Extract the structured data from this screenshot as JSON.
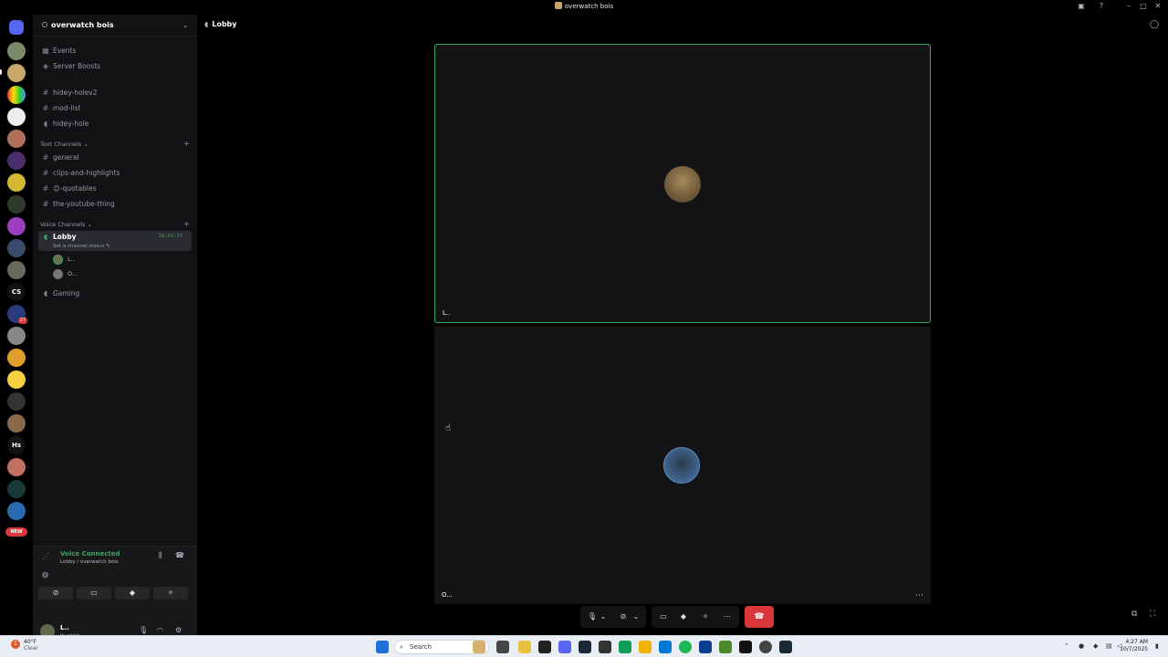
{
  "titlebar": {
    "title": "overwatch bois"
  },
  "guild_rail": {
    "text_icons": [
      "CS",
      "Hs"
    ],
    "new_badge": "NEW",
    "badges": [
      "27"
    ]
  },
  "server": {
    "name": "overwatch bois",
    "top_items": [
      {
        "icon": "calendar-icon",
        "label": "Events"
      },
      {
        "icon": "boost-icon",
        "label": "Server Boosts"
      }
    ],
    "pinned_channels": [
      "hidey-holev2",
      "mod-list",
      "hidey-hole"
    ],
    "text_category": "Text Channels",
    "text_channels": [
      "general",
      "clips-and-highlights",
      "😊-quotables",
      "the-youtube-thing"
    ],
    "voice_category": "Voice Channels",
    "voice_channels": [
      {
        "name": "Lobby",
        "active": true,
        "timer": "18:59:37",
        "status": "Set a channel status",
        "users": [
          "L..",
          "O..."
        ]
      },
      {
        "name": "Gaming",
        "active": false
      }
    ]
  },
  "voice_panel": {
    "status": "Voice Connected",
    "location": "Lobby / overwatch bois"
  },
  "user": {
    "name": "L..",
    "status": "In voice"
  },
  "main": {
    "channel": "Lobby",
    "tiles": [
      {
        "label": "L..",
        "speaking": true
      },
      {
        "label": "O...",
        "speaking": false
      }
    ]
  },
  "taskbar": {
    "weather_temp": "40°F",
    "weather_desc": "Clear",
    "weather_badge": "1",
    "search_placeholder": "Search",
    "time": "4:27 AM",
    "date": "10/7/2025"
  },
  "colors": {
    "accent_green": "#3ba55d",
    "end_call": "#da373c"
  }
}
